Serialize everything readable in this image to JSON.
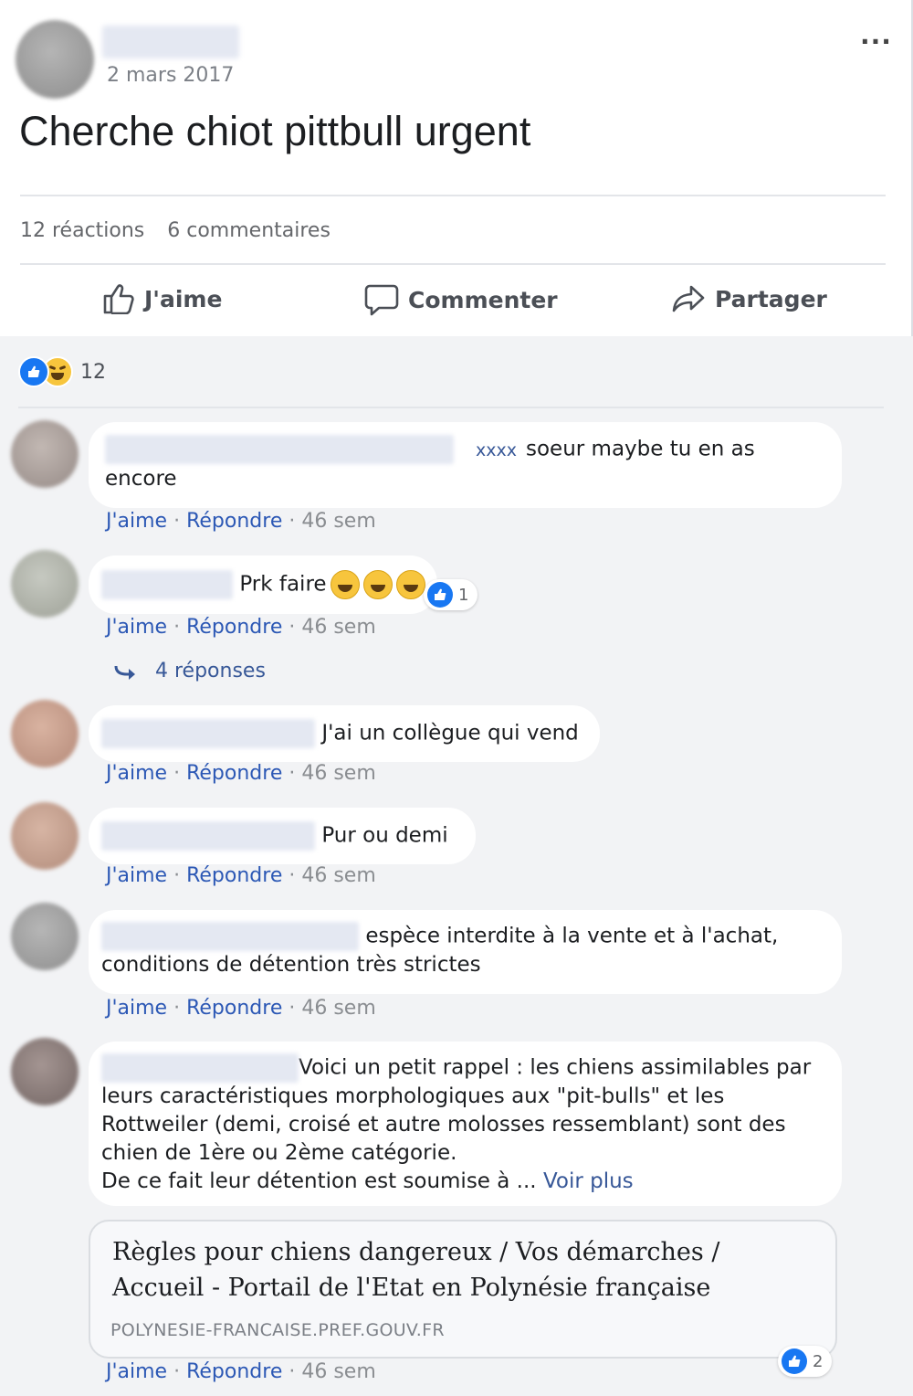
{
  "post": {
    "date": "2 mars 2017",
    "more_label": "...",
    "text": "Cherche chiot pittbull urgent",
    "reactions_count": "12 réactions",
    "comments_count": "6 commentaires",
    "like_label": "J'aime",
    "comment_label": "Commenter",
    "share_label": "Partager"
  },
  "reaction_summary": {
    "count": "12"
  },
  "comments": [
    {
      "mention": "xxxx",
      "text_a": "soeur maybe tu en as",
      "text_b": "encore",
      "like": "J'aime",
      "reply": "Répondre",
      "time": "46 sem"
    },
    {
      "text": "Prk faire",
      "reaction_count": "1",
      "like": "J'aime",
      "reply": "Répondre",
      "time": "46 sem",
      "replies_label": "4 réponses"
    },
    {
      "text": "J'ai un collègue qui vend",
      "like": "J'aime",
      "reply": "Répondre",
      "time": "46 sem"
    },
    {
      "text": "Pur ou demi",
      "like": "J'aime",
      "reply": "Répondre",
      "time": "46 sem"
    },
    {
      "text_a": "espèce interdite à la vente et à l'achat,",
      "text_b": "conditions de détention très strictes",
      "like": "J'aime",
      "reply": "Répondre",
      "time": "46 sem"
    },
    {
      "line1": "Voici un petit rappel : les chiens assimilables par",
      "line2": "leurs caractéristiques morphologiques aux \"pit-bulls\" et les",
      "line3": "Rottweiler (demi, croisé et autre molosses ressemblant) sont des",
      "line4": "chien de 1ère ou 2ème catégorie.",
      "line5": "De ce fait leur détention est soumise à ...",
      "see_more": "Voir plus",
      "link_title": "Règles pour chiens dangereux / Vos démarches / Accueil - Portail de l'Etat en Polynésie française",
      "link_domain": "POLYNESIE-FRANCAISE.PREF.GOUV.FR",
      "reaction_count": "2",
      "like": "J'aime",
      "reply": "Répondre",
      "time": "46 sem"
    }
  ],
  "colors": {
    "link_blue": "#385898",
    "like_blue": "#1877f2",
    "background": "#f2f3f5"
  }
}
